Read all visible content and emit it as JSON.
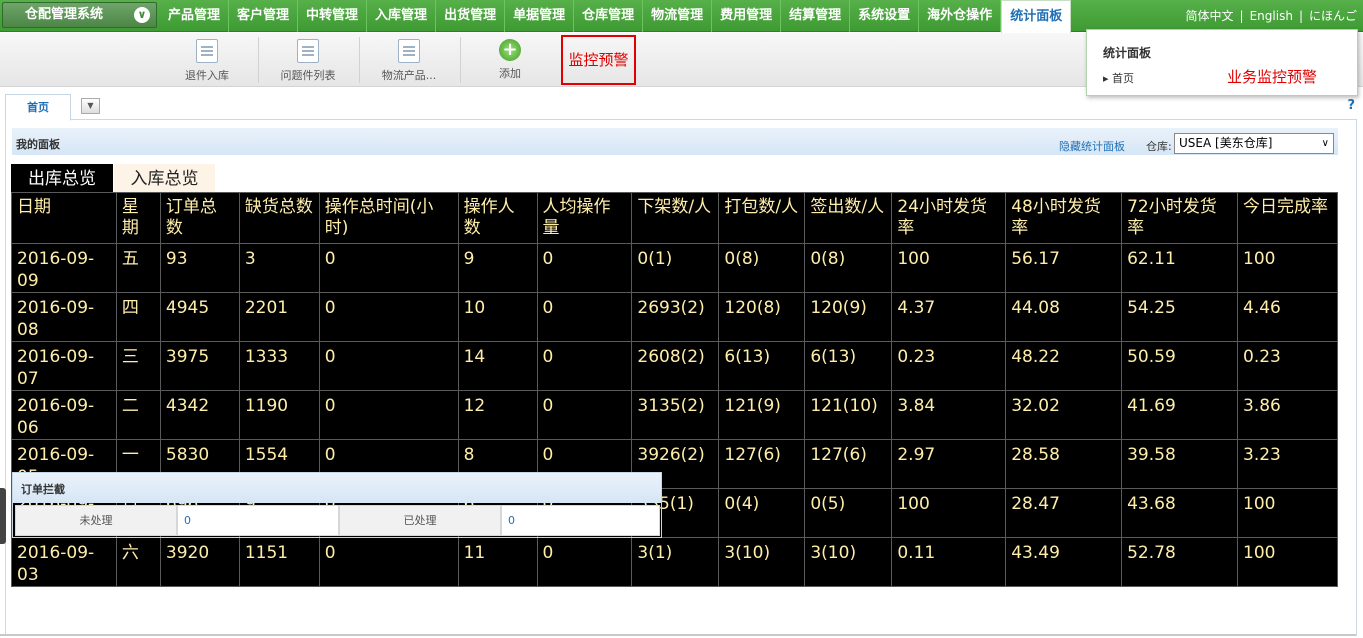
{
  "system_button": {
    "label": "仓配管理系统"
  },
  "nav": {
    "items": [
      {
        "label": "产品管理"
      },
      {
        "label": "客户管理"
      },
      {
        "label": "中转管理"
      },
      {
        "label": "入库管理"
      },
      {
        "label": "出货管理"
      },
      {
        "label": "单据管理"
      },
      {
        "label": "仓库管理"
      },
      {
        "label": "物流管理"
      },
      {
        "label": "费用管理"
      },
      {
        "label": "结算管理"
      },
      {
        "label": "系统设置"
      },
      {
        "label": "海外仓操作"
      },
      {
        "label": "统计面板"
      }
    ],
    "active_index": 12
  },
  "languages": [
    "简体中文",
    "English",
    "にほんご"
  ],
  "toolbar": {
    "buttons": [
      {
        "label": "退件入库",
        "icon": "document-grid-icon"
      },
      {
        "label": "问题件列表",
        "icon": "document-grid-icon"
      },
      {
        "label": "物流产品...",
        "icon": "document-grid-icon"
      },
      {
        "label": "添加",
        "icon": "plus-circle-icon"
      }
    ],
    "monitor_label": "监控预警"
  },
  "stats_popup": {
    "title": "统计面板",
    "home": "首页",
    "annotation": "业务监控预警"
  },
  "tabs": {
    "home": "首页",
    "help": "?"
  },
  "panel": {
    "title": "我的面板",
    "hide_link": "隐藏统计面板",
    "warehouse_label": "仓库:",
    "warehouse_value": "USEA [美东仓库]"
  },
  "subtabs": {
    "outbound": "出库总览",
    "inbound": "入库总览"
  },
  "table": {
    "headers": [
      "日期",
      "星期",
      "订单总数",
      "缺货总数",
      "操作总时间(小时)",
      "操作人数",
      "人均操作量",
      "下架数/人",
      "打包数/人",
      "签出数/人",
      "24小时发货率",
      "48小时发货率",
      "72小时发货率",
      "今日完成率"
    ],
    "rows": [
      [
        "2016-09-09",
        "五",
        "93",
        "3",
        "0",
        "9",
        "0",
        "0(1)",
        "0(8)",
        "0(8)",
        "100",
        "56.17",
        "62.11",
        "100"
      ],
      [
        "2016-09-08",
        "四",
        "4945",
        "2201",
        "0",
        "10",
        "0",
        "2693(2)",
        "120(8)",
        "120(9)",
        "4.37",
        "44.08",
        "54.25",
        "4.46"
      ],
      [
        "2016-09-07",
        "三",
        "3975",
        "1333",
        "0",
        "14",
        "0",
        "2608(2)",
        "6(13)",
        "6(13)",
        "0.23",
        "48.22",
        "50.59",
        "0.23"
      ],
      [
        "2016-09-06",
        "二",
        "4342",
        "1190",
        "0",
        "12",
        "0",
        "3135(2)",
        "121(9)",
        "121(10)",
        "3.84",
        "32.02",
        "41.69",
        "3.86"
      ],
      [
        "2016-09-05",
        "一",
        "5830",
        "1554",
        "0",
        "8",
        "0",
        "3926(2)",
        "127(6)",
        "127(6)",
        "2.97",
        "28.58",
        "39.58",
        "3.23"
      ],
      [
        "2016-09-04",
        "日",
        "696",
        "9",
        "0",
        "6",
        "0",
        "535(1)",
        "0(4)",
        "0(5)",
        "100",
        "28.47",
        "43.68",
        "100"
      ],
      [
        "2016-09-03",
        "六",
        "3920",
        "1151",
        "0",
        "11",
        "0",
        "3(1)",
        "3(10)",
        "3(10)",
        "0.11",
        "43.49",
        "52.78",
        "100"
      ]
    ]
  },
  "intercept": {
    "title": "订单拦截",
    "unprocessed_label": "未处理",
    "unprocessed_value": "0",
    "processed_label": "已处理",
    "processed_value": "0"
  },
  "colors": {
    "nav_green": "#4ea843",
    "accent_blue": "#1f6fb5",
    "alert_red": "#e00000",
    "table_text": "#ffeeaa"
  }
}
